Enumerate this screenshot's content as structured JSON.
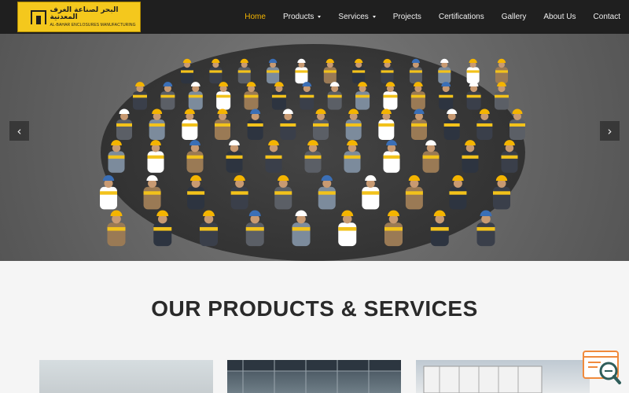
{
  "brand": {
    "arabic_name": "البحر لصناعة الغرف المعدنية",
    "english_name": "AL-BAHAR ENCLOSURES MANUFACTURING",
    "color": "#f4c81d"
  },
  "nav": {
    "items": [
      {
        "label": "Home",
        "active": true
      },
      {
        "label": "Products",
        "dropdown": true
      },
      {
        "label": "Services",
        "dropdown": true
      },
      {
        "label": "Projects"
      },
      {
        "label": "Certifications"
      },
      {
        "label": "Gallery"
      },
      {
        "label": "About Us"
      },
      {
        "label": "Contact"
      }
    ],
    "active_color": "#f4b400"
  },
  "hero": {
    "prev_icon": "‹",
    "next_icon": "›"
  },
  "products": {
    "title": "OUR PRODUCTS & SERVICES"
  },
  "widget": {
    "icon": "chat-search-icon",
    "color": "#f08a3c"
  }
}
